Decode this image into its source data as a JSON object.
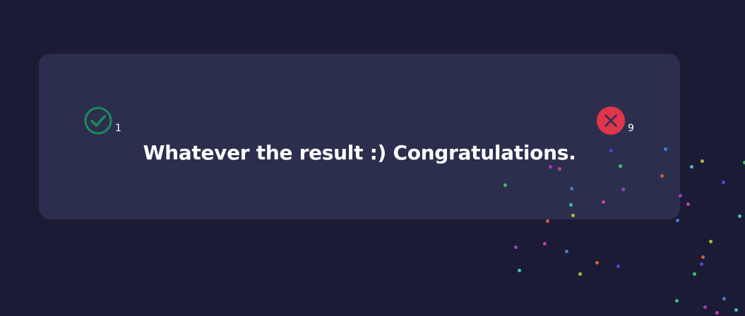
{
  "card": {
    "message": "Whatever the result :) Congratulations.",
    "correct": {
      "count": "1",
      "icon": "check-circle-icon",
      "color": "#1e8a5a"
    },
    "wrong": {
      "count": "9",
      "icon": "x-circle-icon",
      "color": "#e0354b"
    }
  },
  "colors": {
    "background": "#1b1b35",
    "card": "#2b2f4d",
    "text": "#ffffff"
  },
  "confetti_palette": [
    "#3fbf6f",
    "#9b3fbf",
    "#c23fa6",
    "#3f7fd6",
    "#3fbfbf",
    "#b5b53f",
    "#d65a3f",
    "#5a3fd6"
  ]
}
